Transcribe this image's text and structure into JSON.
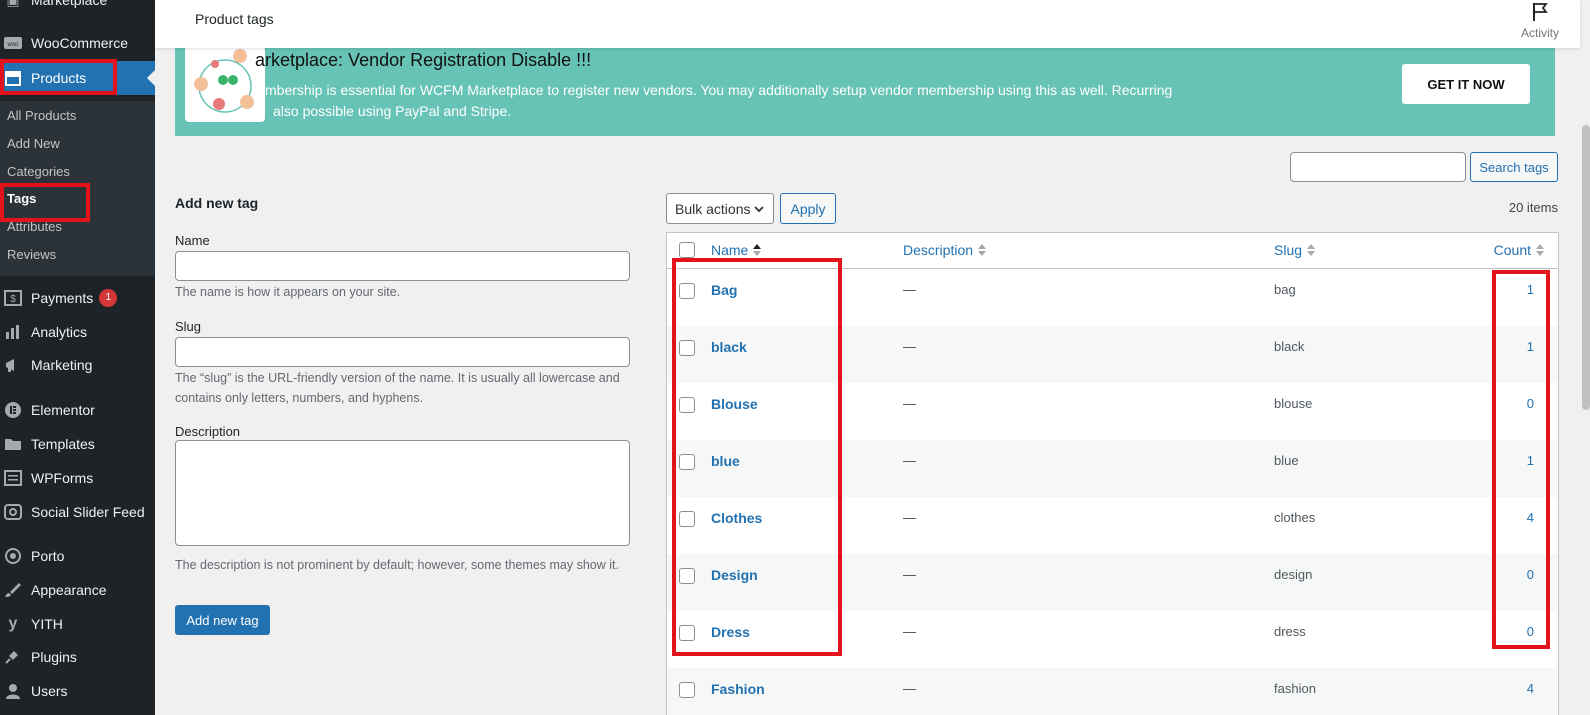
{
  "sidebar": {
    "top_partial": "Marketplace",
    "items": [
      {
        "label": "WooCommerce",
        "icon": "woo-icon"
      },
      {
        "label": "Products",
        "icon": "archive-icon"
      },
      {
        "label": "Payments",
        "icon": "dollar-icon",
        "badge": "1"
      },
      {
        "label": "Analytics",
        "icon": "bar-chart-icon"
      },
      {
        "label": "Marketing",
        "icon": "megaphone-icon"
      },
      {
        "label": "Elementor",
        "icon": "elementor-icon"
      },
      {
        "label": "Templates",
        "icon": "folder-icon"
      },
      {
        "label": "WPForms",
        "icon": "forms-icon"
      },
      {
        "label": "Social Slider Feed",
        "icon": "instagram-icon"
      },
      {
        "label": "Porto",
        "icon": "porto-icon"
      },
      {
        "label": "Appearance",
        "icon": "brush-icon"
      },
      {
        "label": "YITH",
        "icon": "yith-icon"
      },
      {
        "label": "Plugins",
        "icon": "plug-icon"
      },
      {
        "label": "Users",
        "icon": "user-icon"
      }
    ],
    "submenu": [
      "All Products",
      "Add New",
      "Categories",
      "Tags",
      "Attributes",
      "Reviews"
    ]
  },
  "topbar": {
    "title": "Product tags",
    "activity": "Activity"
  },
  "banner": {
    "headline": "arketplace: Vendor Registration Disable !!!",
    "line1": "mbership is essential for WCFM Marketplace to register new vendors. You may additionally setup vendor membership using this as well. Recurring",
    "line2": "also possible using PayPal and Stripe.",
    "cta": "GET IT NOW"
  },
  "form": {
    "heading": "Add new tag",
    "name_label": "Name",
    "name_help": "The name is how it appears on your site.",
    "slug_label": "Slug",
    "slug_help": "The “slug” is the URL-friendly version of the name. It is usually all lowercase and contains only letters, numbers, and hyphens.",
    "desc_label": "Description",
    "desc_help": "The description is not prominent by default; however, some themes may show it.",
    "submit": "Add new tag"
  },
  "search": {
    "button": "Search tags",
    "value": ""
  },
  "bulk": {
    "selected": "Bulk actions",
    "apply": "Apply",
    "items_count": "20 items"
  },
  "table": {
    "headers": {
      "name": "Name",
      "description": "Description",
      "slug": "Slug",
      "count": "Count"
    },
    "rows": [
      {
        "name": "Bag",
        "description": "—",
        "slug": "bag",
        "count": "1"
      },
      {
        "name": "black",
        "description": "—",
        "slug": "black",
        "count": "1"
      },
      {
        "name": "Blouse",
        "description": "—",
        "slug": "blouse",
        "count": "0"
      },
      {
        "name": "blue",
        "description": "—",
        "slug": "blue",
        "count": "1"
      },
      {
        "name": "Clothes",
        "description": "—",
        "slug": "clothes",
        "count": "4"
      },
      {
        "name": "Design",
        "description": "—",
        "slug": "design",
        "count": "0"
      },
      {
        "name": "Dress",
        "description": "—",
        "slug": "dress",
        "count": "0"
      },
      {
        "name": "Fashion",
        "description": "—",
        "slug": "fashion",
        "count": "4"
      }
    ]
  },
  "colors": {
    "sidebar": "#1d2327",
    "accent": "#2271b1",
    "banner": "#67c3b5",
    "highlight": "#e3131b"
  }
}
